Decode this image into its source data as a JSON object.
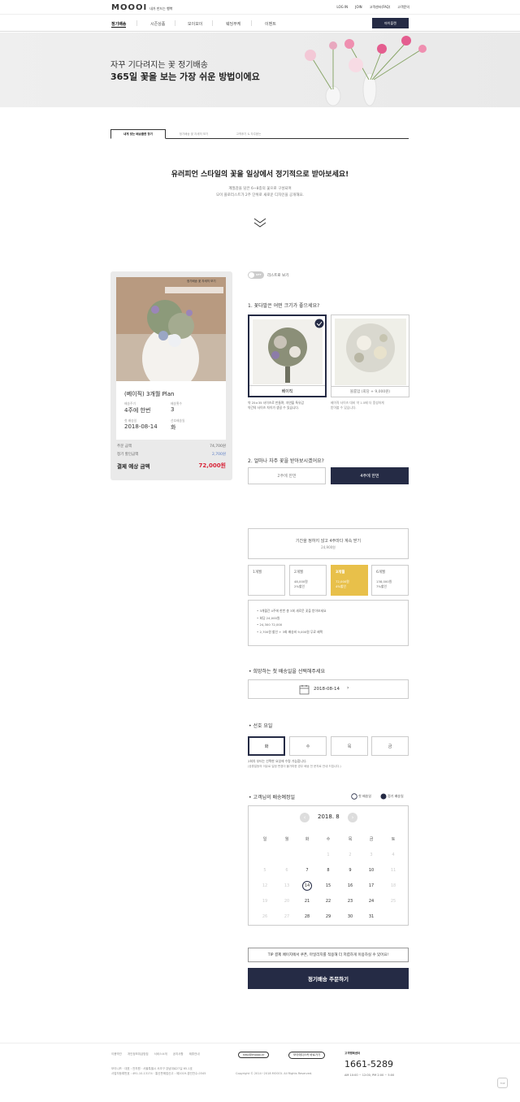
{
  "header": {
    "logo": "MOOOI",
    "tagline": "내가 만드는 행복",
    "links": [
      "LOG IN",
      "JOIN",
      "고객센터(FAQ)",
      "고객문의"
    ],
    "nav": [
      "정기배송",
      "시즌상품",
      "모이모이",
      "웨딩부케",
      "이벤트"
    ],
    "mypage": "마이플랜"
  },
  "hero": {
    "line1": "자꾸 기다려지는 꽃 정기배송",
    "line2": "365일 꽃을 보는 가장 쉬운 방법이에요"
  },
  "tabs": [
    "내게 맞는 배송플랜 찾기",
    "정기배송 꽃 자세히 보기",
    "고객후기 & 자주묻는"
  ],
  "intro": {
    "headline": "유러피언 스타일의 꽃을 일상에서 정기적으로 받아보세요!",
    "desc1": "계절감을 담은 6~8종의 꽃으로 구성되며",
    "desc2": "모이 플로리스트가 2주 단위로 새로운 디자인을 공개해요."
  },
  "summary": {
    "badge": "정기배송 꽃 자세히 보기",
    "plan": "(베이직) 3개월 Plan",
    "f1_label": "배송주기",
    "f1_val": "4주에 한번",
    "f2_label": "배송횟수",
    "f2_val": "3",
    "f3_label": "첫 배송일",
    "f3_val": "2018-08-14",
    "f4_label": "선호배송일",
    "f4_val": "화",
    "order_label": "주문 금액",
    "order_val": "74,700원",
    "disc_label": "정기 할인금액",
    "disc_val": "2,700원",
    "total_label": "결제 예상 금액",
    "total_val": "72,000원"
  },
  "options": {
    "toggle": "OFF",
    "toggle_label": "리스트로 보기",
    "q1": "1. 꽃다발은 어떤 크기가 좋으세요?",
    "size1": "베이직",
    "size2": "볼륨업 (회당 + 9,000원)",
    "size1_desc1": "약 25×35 사이즈로 만들며, 자연물 특유감",
    "size1_desc2": "약간의 사이즈 차이가 생길 수 있습니다.",
    "size2_desc1": "베이직 사이즈 대비 약 1.5배 더 풍성하게",
    "size2_desc2": "받아볼 수 있습니다.",
    "q2": "2. 얼마나 자주 꽃을 받아보시겠어요?",
    "freq1": "2주에 한번",
    "freq2": "4주에 한번"
  },
  "period": {
    "nolimit": "기간을 정하지 않고 4주마다 계속 받기",
    "nolimit_price": "24,900원",
    "plans": [
      {
        "label": "1개월",
        "price": "",
        "disc": ""
      },
      {
        "label": "2개월",
        "price": "48,000원",
        "disc": "2%할인"
      },
      {
        "label": "3개월",
        "price": "72,000원",
        "disc": "4%할인"
      },
      {
        "label": "6개월",
        "price": "138,000원",
        "disc": "7%할인"
      }
    ],
    "notes": [
      "• 3개월간 4주에 한번 총 3회 새로운 꽃을 받아보세요",
      "• 회당 24,000원",
      "• 24,300 72,000",
      "• 2,700원 할인 + 3회 배송비 9,000원 무료 혜택"
    ]
  },
  "firstday": {
    "title": "희망하는 첫 배송일을 선택해주세요",
    "date": "2018-08-14"
  },
  "pref": {
    "title": "선호 요일",
    "days": [
      "화",
      "수",
      "목",
      "금"
    ],
    "note1": "2회차 부터는 선택한 요일에 수령 가능합니다.",
    "note2": "(공휴일등의 이유로 일정 변경이 불가피한 경우 배송 전 문자로 안내 드립니다.)"
  },
  "calendar": {
    "title": "고객님의 배송예정일",
    "legend1": "첫 배송일",
    "legend2": "정기 배송일",
    "month": "2018. 8",
    "weekdays": [
      "일",
      "월",
      "화",
      "수",
      "목",
      "금",
      "토"
    ],
    "weeks": [
      [
        "",
        "",
        "",
        "1",
        "2",
        "3",
        "4"
      ],
      [
        "5",
        "6",
        "7",
        "8",
        "9",
        "10",
        "11"
      ],
      [
        "12",
        "13",
        "14",
        "15",
        "16",
        "17",
        "18"
      ],
      [
        "19",
        "20",
        "21",
        "22",
        "23",
        "24",
        "25"
      ],
      [
        "26",
        "27",
        "28",
        "29",
        "30",
        "31",
        ""
      ]
    ]
  },
  "tip": "TIP 결제 페이지에서 쿠폰, 마일리지를 적용해 더 저렴하게 이용하실 수 있어요!",
  "order_button": "정기배송 주문하기",
  "footer": {
    "links": [
      "이용약관",
      "개인정보취급방침",
      "서비스소개",
      "공지사항",
      "제휴안내"
    ],
    "email": "help@moooi.kr",
    "kakao": "모이에디스커 바로가기",
    "addr1": "모이니즈 · 대표 : 전지원 · 서울특별시 서초구 강남대로27길 65-1호",
    "addr2": "사업자등록번호 : 491-10-13174 · 통신판매업신고 : 제2019-경인천수-0345",
    "copy": "Copyright © 2014~2018 MOOOI. All Rights Reserved.",
    "cs_title": "고객행복센터",
    "phone": "1661-5289",
    "hours": "AM 10:00 ~ 12:00, PM 2:00 ~ 5:00",
    "top": "TOP"
  }
}
